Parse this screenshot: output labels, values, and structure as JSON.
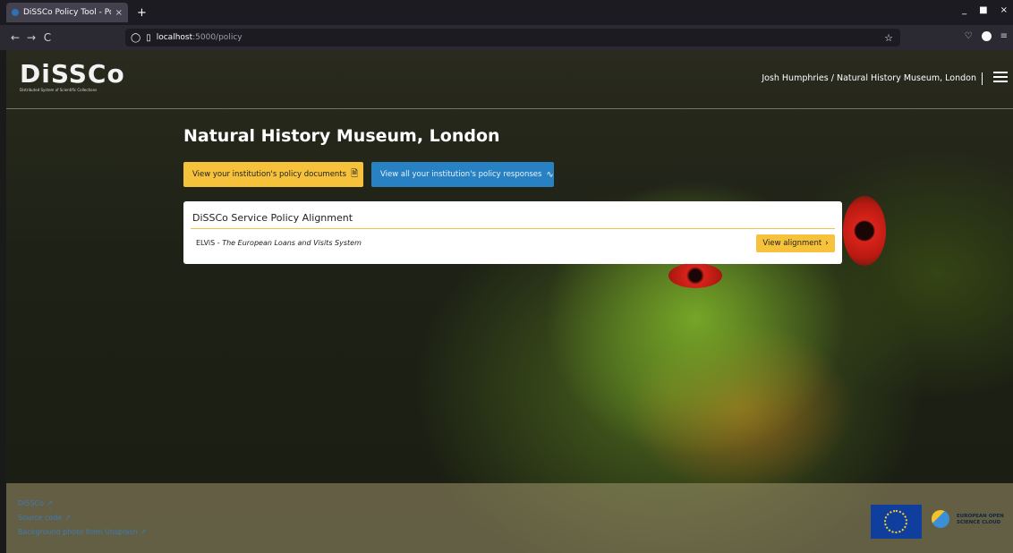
{
  "browser": {
    "tab_title": "DiSSCo Policy Tool - Polic",
    "tab_close": "×",
    "new_tab": "+",
    "url_host": "localhost",
    "url_path": ":5000/policy",
    "nav": {
      "back": "←",
      "forward": "→",
      "reload": "C"
    },
    "window_controls": [
      "_",
      "■",
      "×"
    ]
  },
  "header": {
    "logo_text": "DiSSCo",
    "logo_subtitle": "Distributed System of Scientific Collections",
    "user": "Josh Humphries / Natural History Museum, London"
  },
  "main": {
    "institution": "Natural History Museum, London",
    "buttons": {
      "docs_label": "View your institution's policy documents",
      "responses_label": "View all your institution's policy responses"
    },
    "card": {
      "title": "DiSSCo Service Policy Alignment",
      "row": {
        "code": "ELViS",
        "separator": " - ",
        "name": "The European Loans and Visits System"
      },
      "action_label": "View alignment"
    }
  },
  "footer": {
    "links": [
      "DiSSCo",
      "Source code",
      "Background photo from Unsplash"
    ],
    "eosc_line1": "EUROPEAN OPEN",
    "eosc_line2": "SCIENCE CLOUD"
  },
  "icons": {
    "menu": "menu-icon",
    "document": "document-icon",
    "activity": "activity-icon",
    "external": "external-link-icon"
  },
  "colors": {
    "accent_yellow": "#f7c23b",
    "accent_blue": "#2781c3",
    "link_blue": "#3d7ab8"
  }
}
